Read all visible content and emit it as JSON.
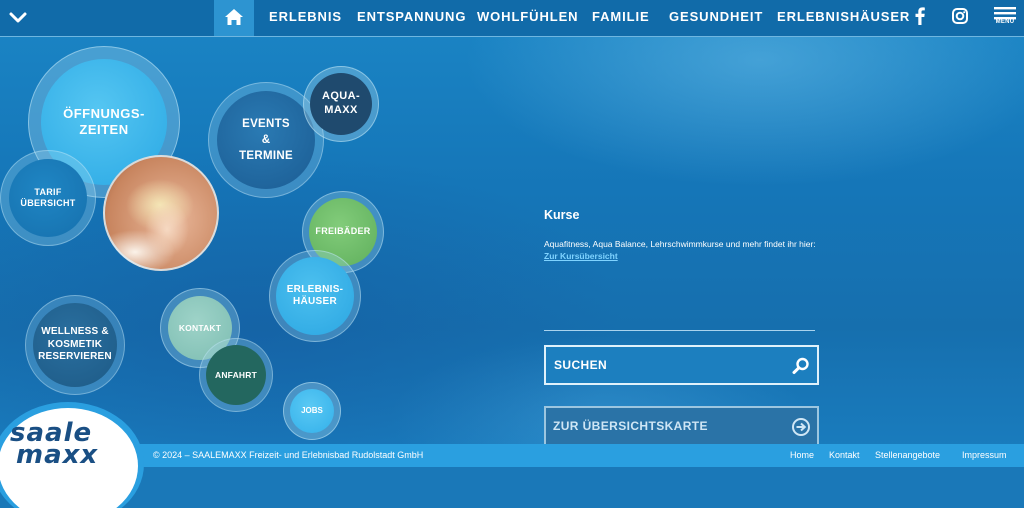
{
  "nav": {
    "items": [
      "ERLEBNIS",
      "ENTSPANNUNG",
      "WOHLFÜHLEN",
      "FAMILIE",
      "GESUNDHEIT",
      "ERLEBNISHÄUSER"
    ],
    "menu_label": "MENÜ",
    "icons": [
      "chevron-down-icon",
      "home-icon",
      "facebook-icon",
      "instagram-icon",
      "hamburger-icon"
    ]
  },
  "bubbles": {
    "oeffnungszeiten": [
      "ÖFFNUNGS-",
      "ZEITEN"
    ],
    "events": [
      "EVENTS",
      "&",
      "TERMINE"
    ],
    "aquamaxx": [
      "AQUA-",
      "MAXX"
    ],
    "tarif": [
      "TARIF",
      "ÜBERSICHT"
    ],
    "freibaeder": [
      "FREIBÄDER"
    ],
    "erlebnishaeuser": [
      "ERLEBNIS-",
      "HÄUSER"
    ],
    "wellness": [
      "WELLNESS &",
      "KOSMETIK",
      "RESERVIEREN"
    ],
    "kontakt": [
      "KONTAKT"
    ],
    "anfahrt": [
      "ANFAHRT"
    ],
    "jobs": [
      "JOBS"
    ]
  },
  "content": {
    "title": "Kurse",
    "text": "Aquafitness, Aqua Balance, Lehrschwimmkurse und mehr findet ihr hier: ",
    "link": "Zur Kursübersicht"
  },
  "search": {
    "label": "SUCHEN"
  },
  "map_button": {
    "label": "ZUR ÜBERSICHTSKARTE"
  },
  "logo": {
    "line1": "saale",
    "line2": "maxx"
  },
  "footer": {
    "copyright": "© 2024 – SAALEMAXX Freizeit- und Erlebnisbad Rudolstadt GmbH",
    "links": [
      "Home",
      "Kontakt",
      "Stellenangebote",
      "Impressum"
    ]
  },
  "colors": {
    "nav_bg": "#116ba9",
    "home_active": "#2d94d1",
    "footer_bg": "#2a9fe0",
    "bubble_light": "#3bb6ea",
    "bubble_dark": "#1f4a6e",
    "bubble_green": "#6dbb6b",
    "bubble_mint": "#8cc9bf",
    "bubble_teal": "#23675f"
  }
}
